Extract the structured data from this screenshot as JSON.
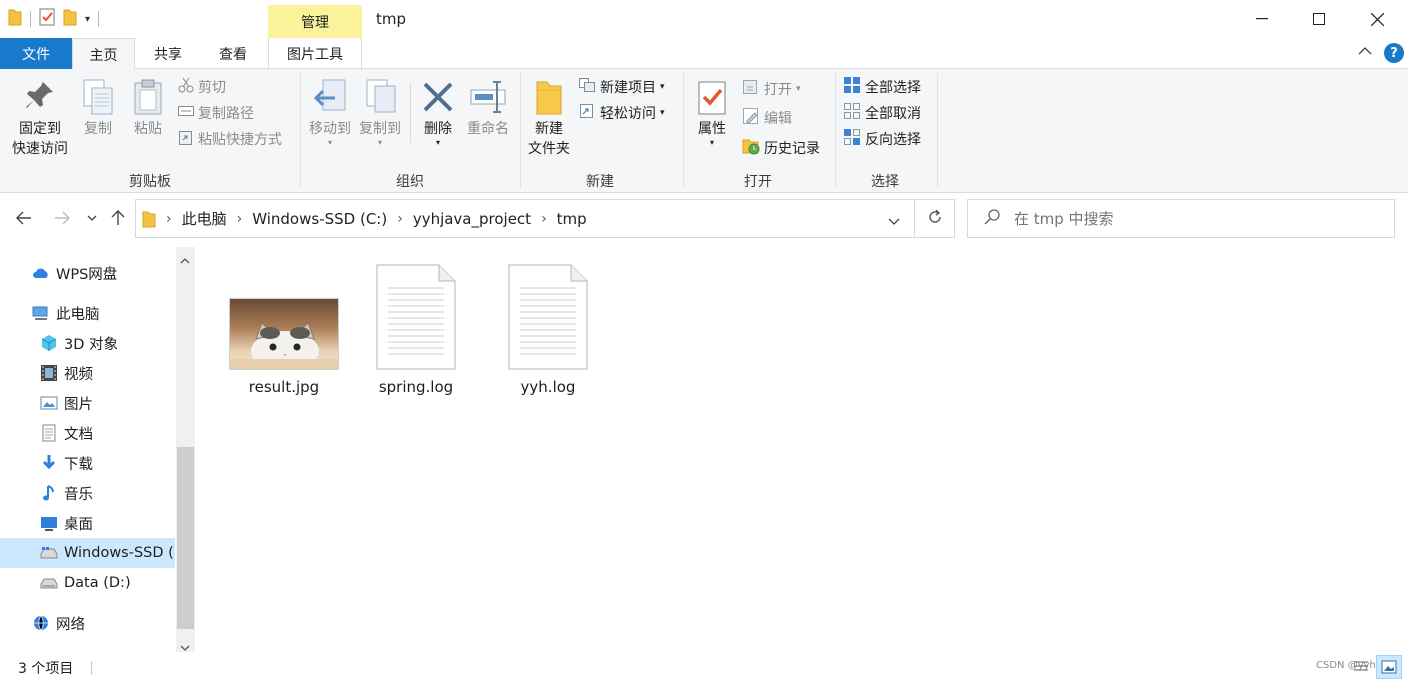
{
  "window": {
    "title": "tmp",
    "context_tab_label": "管理",
    "controls": {
      "minimize": "—",
      "maximize": "☐",
      "close": "✕"
    }
  },
  "tabs": {
    "file": "文件",
    "home": "主页",
    "share": "共享",
    "view": "查看",
    "picture_tools": "图片工具"
  },
  "ribbon": {
    "clipboard": {
      "label": "剪贴板",
      "pin_line1": "固定到",
      "pin_line2": "快速访问",
      "copy": "复制",
      "paste": "粘贴",
      "cut": "剪切",
      "copy_path": "复制路径",
      "paste_shortcut": "粘贴快捷方式"
    },
    "organize": {
      "label": "组织",
      "move_to": "移动到",
      "copy_to": "复制到",
      "delete": "删除",
      "rename": "重命名"
    },
    "new": {
      "label": "新建",
      "new_folder_line1": "新建",
      "new_folder_line2": "文件夹",
      "new_item": "新建项目",
      "easy_access": "轻松访问"
    },
    "open": {
      "label": "打开",
      "properties": "属性",
      "open": "打开",
      "edit": "编辑",
      "history": "历史记录"
    },
    "select": {
      "label": "选择",
      "select_all": "全部选择",
      "select_none": "全部取消",
      "invert": "反向选择"
    }
  },
  "address": {
    "crumbs": [
      "此电脑",
      "Windows-SSD (C:)",
      "yyhjava_project",
      "tmp"
    ],
    "search_placeholder": "在 tmp 中搜索"
  },
  "nav": {
    "items": [
      {
        "label": "WPS网盘",
        "icon": "cloud-icon"
      },
      {
        "label": "此电脑",
        "icon": "computer-icon"
      },
      {
        "label": "3D 对象",
        "icon": "cube-icon"
      },
      {
        "label": "视频",
        "icon": "video-icon"
      },
      {
        "label": "图片",
        "icon": "picture-icon"
      },
      {
        "label": "文档",
        "icon": "document-icon"
      },
      {
        "label": "下载",
        "icon": "download-icon"
      },
      {
        "label": "音乐",
        "icon": "music-icon"
      },
      {
        "label": "桌面",
        "icon": "desktop-icon"
      },
      {
        "label": "Windows-SSD (",
        "icon": "drive-icon"
      },
      {
        "label": "Data (D:)",
        "icon": "drive-icon"
      },
      {
        "label": "网络",
        "icon": "network-icon"
      }
    ],
    "selected": "Windows-SSD ("
  },
  "files": [
    {
      "name": "result.jpg",
      "type": "image"
    },
    {
      "name": "spring.log",
      "type": "text"
    },
    {
      "name": "yyh.log",
      "type": "text"
    }
  ],
  "status": {
    "count_text": "3 个项目",
    "watermark": "CSDN @yyh"
  },
  "colors": {
    "file_tab": "#1979ca",
    "context_tab": "#fbf29c",
    "selection": "#cce8ff",
    "ribbon_bg": "#f5f6f7"
  }
}
